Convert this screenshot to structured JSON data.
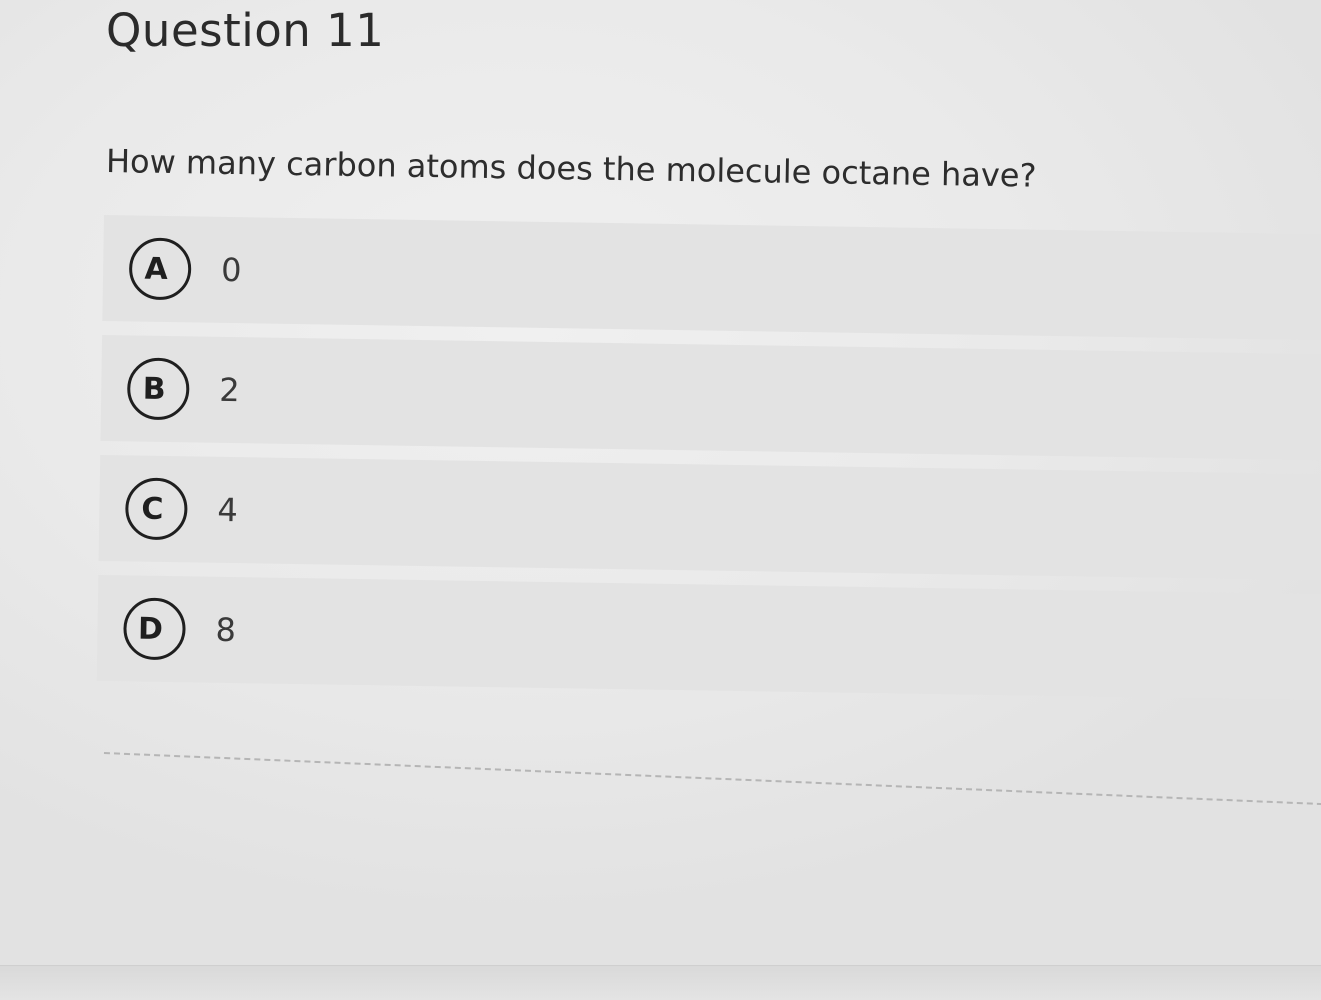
{
  "question": {
    "title": "Question 11",
    "prompt": "How many carbon atoms does the molecule octane have?"
  },
  "options": [
    {
      "letter": "A",
      "value": "0"
    },
    {
      "letter": "B",
      "value": "2"
    },
    {
      "letter": "C",
      "value": "4"
    },
    {
      "letter": "D",
      "value": "8"
    }
  ]
}
